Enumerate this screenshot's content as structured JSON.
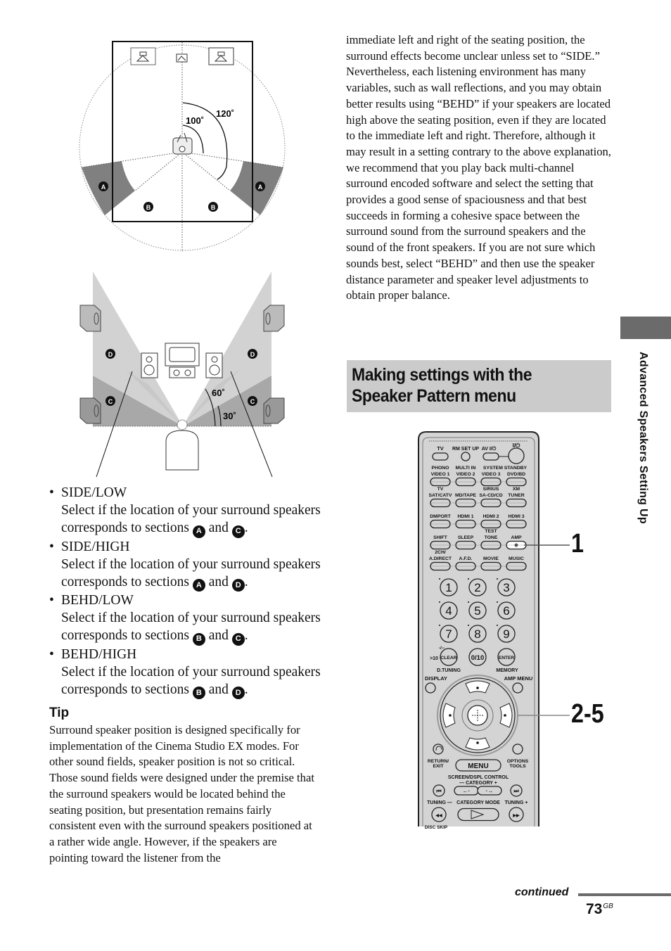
{
  "diagram_top": {
    "angles": {
      "inner": "100˚",
      "outer": "120˚"
    },
    "sections": {
      "a_left": "A",
      "a_right": "A",
      "b_left": "B",
      "b_right": "B"
    }
  },
  "diagram_bottom": {
    "angles": {
      "upper": "60˚",
      "lower": "30˚"
    },
    "sections": {
      "d_left": "D",
      "d_right": "D",
      "c_left": "C",
      "c_right": "C"
    }
  },
  "options": [
    {
      "title": "SIDE/LOW",
      "desc": "Select if the location of your surround speakers corresponds to sections",
      "s1": "A",
      "s2": "C"
    },
    {
      "title": "SIDE/HIGH",
      "desc": "Select if the location of your surround speakers corresponds to sections",
      "s1": "A",
      "s2": "D"
    },
    {
      "title": "BEHD/LOW",
      "desc": "Select if the location of your surround speakers corresponds to sections",
      "s1": "B",
      "s2": "C"
    },
    {
      "title": "BEHD/HIGH",
      "desc": "Select if the location of your surround speakers corresponds to sections",
      "s1": "B",
      "s2": "D"
    }
  ],
  "connector": "and",
  "bullet": "•",
  "tip": {
    "heading": "Tip",
    "p1": "Surround speaker position is designed specifically for implementation of the Cinema Studio EX modes. For other sound fields, speaker position is not so critical.",
    "p2": "Those sound fields were designed under the premise that the surround speakers would be located behind the seating position, but presentation remains fairly consistent even with the surround speakers positioned at a rather wide angle. However, if the speakers are pointing toward the listener from the"
  },
  "right_column": {
    "p1": "immediate left and right of the seating position, the surround effects become unclear unless set to “SIDE.”",
    "p2": "Nevertheless, each listening environment has many variables, such as wall reflections, and you may obtain better results using “BEHD” if your speakers are located high above the seating position, even if they are located to the immediate left and right. Therefore, although it may result in a setting contrary to the above explanation, we recommend that you play back multi-channel surround encoded software and select the setting that provides a good sense of spaciousness and that best succeeds in forming a cohesive space between the surround sound from the surround speakers and the sound of the front speakers. If you are not sure which sounds best, select “BEHD” and then use the speaker distance parameter and speaker level adjustments to obtain proper balance."
  },
  "section": {
    "title_line1": "Making settings with the",
    "title_line2": "Speaker Pattern menu"
  },
  "side_tab": {
    "label": "Advanced Speakers Setting Up"
  },
  "remote": {
    "row1": {
      "tv": "TV",
      "rm_set_up": "RM SET UP",
      "av": "AV I/⏻",
      "power": "I/⏻",
      "system_standby": "SYSTEM STANDBY"
    },
    "row2": [
      {
        "top": "PHONO",
        "bottom": "VIDEO 1"
      },
      {
        "top": "MULTI IN",
        "bottom": "VIDEO 2"
      },
      {
        "top": "",
        "bottom": "VIDEO 3"
      },
      {
        "top": "",
        "bottom": "DVD/BD"
      }
    ],
    "row3": [
      {
        "top": "TV",
        "bottom": "SAT/CATV"
      },
      {
        "top": "",
        "bottom": "MD/TAPE"
      },
      {
        "top": "SIRIUS",
        "bottom": "SA-CD/CD"
      },
      {
        "top": "XM",
        "bottom": "TUNER"
      }
    ],
    "row4": [
      {
        "top": "",
        "bottom": "DMPORT"
      },
      {
        "top": "",
        "bottom": "HDMI 1"
      },
      {
        "top": "",
        "bottom": "HDMI 2"
      },
      {
        "top": "",
        "bottom": "HDMI 3"
      }
    ],
    "row5": [
      {
        "top": "",
        "bottom": "SHIFT"
      },
      {
        "top": "",
        "bottom": "SLEEP"
      },
      {
        "top": "TEST",
        "bottom": "TONE"
      },
      {
        "top": "",
        "bottom": "AMP"
      }
    ],
    "row6": [
      {
        "top": "2CH/",
        "bottom": "A.DIRECT"
      },
      {
        "top": "",
        "bottom": "A.F.D."
      },
      {
        "top": "",
        "bottom": "MOVIE"
      },
      {
        "top": "",
        "bottom": "MUSIC"
      }
    ],
    "digits": [
      "1",
      "2",
      "3",
      "4",
      "5",
      "6",
      "7",
      "8",
      "9"
    ],
    "clear": "CLEAR",
    "zero": "0/10",
    "enter": "ENTER",
    "dash": "-/--",
    "gt10": ">10",
    "d_tuning": "D.TUNING",
    "memory": "MEMORY",
    "display": "DISPLAY",
    "amp_menu": "AMP MENU",
    "return_exit_1": "RETURN/",
    "return_exit_2": "EXIT",
    "menu": "MENU",
    "options_1": "OPTIONS",
    "options_2": "TOOLS",
    "screen_ctrl": "SCREEN/DSPL CONTROL",
    "category": "— CATEGORY +",
    "tuning_minus": "TUNING —",
    "category_mode": "CATEGORY MODE",
    "tuning_plus": "TUNING +",
    "disc_skip": "DISC SKIP"
  },
  "steps": {
    "step1": "1",
    "step2": "2-5"
  },
  "footer": {
    "continued": "continued",
    "page": "73",
    "page_suffix": "GB"
  }
}
